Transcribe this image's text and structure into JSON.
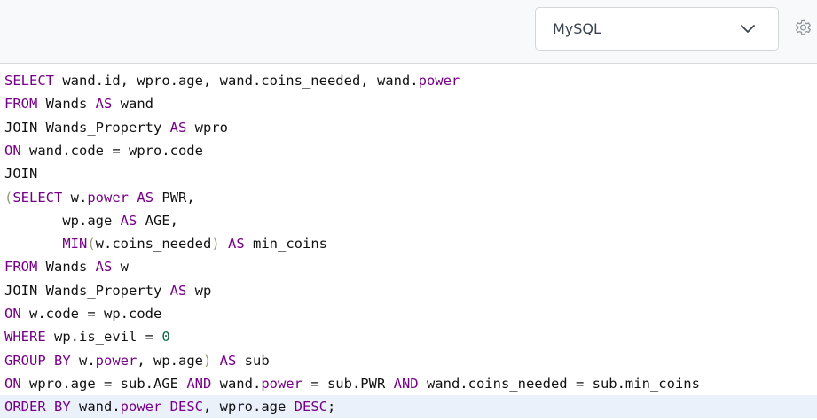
{
  "toolbar": {
    "language": "MySQL",
    "dropdown_icon": "chevron-down-icon",
    "settings_icon": "gear-icon"
  },
  "colors": {
    "keyword": "#770088",
    "text": "#111111",
    "bracket": "#999977",
    "number": "#116644",
    "active_line": "#eaf1fb"
  },
  "editor": {
    "active_line": 15,
    "lines": [
      [
        [
          "kw",
          "SELECT"
        ],
        [
          "p",
          " wand.id, wpro.age, wand.coins_needed, wand."
        ],
        [
          "kw",
          "power"
        ]
      ],
      [
        [
          "kw",
          "FROM"
        ],
        [
          "p",
          " Wands "
        ],
        [
          "kw",
          "AS"
        ],
        [
          "p",
          " wand"
        ]
      ],
      [
        [
          "p",
          "JOIN Wands_Property "
        ],
        [
          "kw",
          "AS"
        ],
        [
          "p",
          " wpro"
        ]
      ],
      [
        [
          "kw",
          "ON"
        ],
        [
          "p",
          " wand.code = wpro.code"
        ]
      ],
      [
        [
          "p",
          "JOIN"
        ]
      ],
      [
        [
          "br",
          "("
        ],
        [
          "kw",
          "SELECT"
        ],
        [
          "p",
          " w."
        ],
        [
          "kw",
          "power"
        ],
        [
          "p",
          " "
        ],
        [
          "kw",
          "AS"
        ],
        [
          "p",
          " PWR,"
        ]
      ],
      [
        [
          "p",
          "       wp.age "
        ],
        [
          "kw",
          "AS"
        ],
        [
          "p",
          " AGE,"
        ]
      ],
      [
        [
          "p",
          "       "
        ],
        [
          "kw",
          "MIN"
        ],
        [
          "br",
          "("
        ],
        [
          "p",
          "w.coins_needed"
        ],
        [
          "br",
          ")"
        ],
        [
          "p",
          " "
        ],
        [
          "kw",
          "AS"
        ],
        [
          "p",
          " min_coins"
        ]
      ],
      [
        [
          "kw",
          "FROM"
        ],
        [
          "p",
          " Wands "
        ],
        [
          "kw",
          "AS"
        ],
        [
          "p",
          " w"
        ]
      ],
      [
        [
          "p",
          "JOIN Wands_Property "
        ],
        [
          "kw",
          "AS"
        ],
        [
          "p",
          " wp"
        ]
      ],
      [
        [
          "kw",
          "ON"
        ],
        [
          "p",
          " w.code = wp.code"
        ]
      ],
      [
        [
          "kw",
          "WHERE"
        ],
        [
          "p",
          " wp.is_evil = "
        ],
        [
          "num",
          "0"
        ]
      ],
      [
        [
          "kw",
          "GROUP BY"
        ],
        [
          "p",
          " w."
        ],
        [
          "kw",
          "power"
        ],
        [
          "p",
          ", wp.age"
        ],
        [
          "br",
          ")"
        ],
        [
          "p",
          " "
        ],
        [
          "kw",
          "AS"
        ],
        [
          "p",
          " sub"
        ]
      ],
      [
        [
          "kw",
          "ON"
        ],
        [
          "p",
          " wpro.age = sub.AGE "
        ],
        [
          "kw",
          "AND"
        ],
        [
          "p",
          " wand."
        ],
        [
          "kw",
          "power"
        ],
        [
          "p",
          " = sub.PWR "
        ],
        [
          "kw",
          "AND"
        ],
        [
          "p",
          " wand.coins_needed = sub.min_coins"
        ]
      ],
      [
        [
          "kw",
          "ORDER BY"
        ],
        [
          "p",
          " wand."
        ],
        [
          "kw",
          "power"
        ],
        [
          "p",
          " "
        ],
        [
          "kw",
          "DESC"
        ],
        [
          "p",
          ", wpro.age "
        ],
        [
          "kw",
          "DESC"
        ],
        [
          "p",
          ";"
        ]
      ]
    ]
  }
}
